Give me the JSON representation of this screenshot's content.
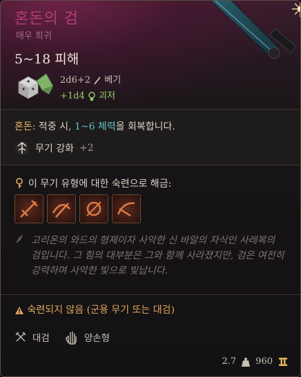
{
  "item": {
    "name": "혼돈의 검",
    "rarity": "매우 희귀",
    "damage": "5~18 피해",
    "dice": "2d6+2",
    "damage_type": "베기",
    "bonus_dice": "+1d4",
    "bonus_type": "괴저"
  },
  "effect": {
    "name": "혼돈:",
    "text_before": " 적중 시, ",
    "highlight": "1~6 체력",
    "text_after": "을 회복합니다."
  },
  "upgrade": {
    "label": "무기 강화",
    "value": "+2"
  },
  "proficiency": {
    "heading": "이 무기 유형에 대한 숙련으로 해금:"
  },
  "lore": "고리온의 와드의 형제이자 사악한 신 바알의 자식인 사레복의 검입니다. 그 힘의 대부분은 그와 함께 사라졌지만, 검은 여전히 강력하며 사악한 빛으로 빛납니다.",
  "warning": {
    "prefix": "숙련",
    "rest": "되지 않음 (군용 무기 또는 대검)"
  },
  "tags": {
    "category": "대검",
    "handedness": "양손형"
  },
  "stats": {
    "weight": "2.7",
    "value": "960"
  },
  "colors": {
    "title": "#b63c79",
    "rarity": "#a86886",
    "bonus_damage": "#8fcf6c",
    "highlight": "#5cc6c0",
    "warning": "#e0a55a",
    "gold": "#e0b45a"
  },
  "icons": [
    "sword-art",
    "dice-icon",
    "slash-icon",
    "necrotic-icon",
    "upgrade-icon",
    "key-icon",
    "weapon-action-icon",
    "lore-feather-icon",
    "warning-icon",
    "greatsword-icon",
    "hand-icon",
    "weight-icon",
    "gold-icon"
  ]
}
